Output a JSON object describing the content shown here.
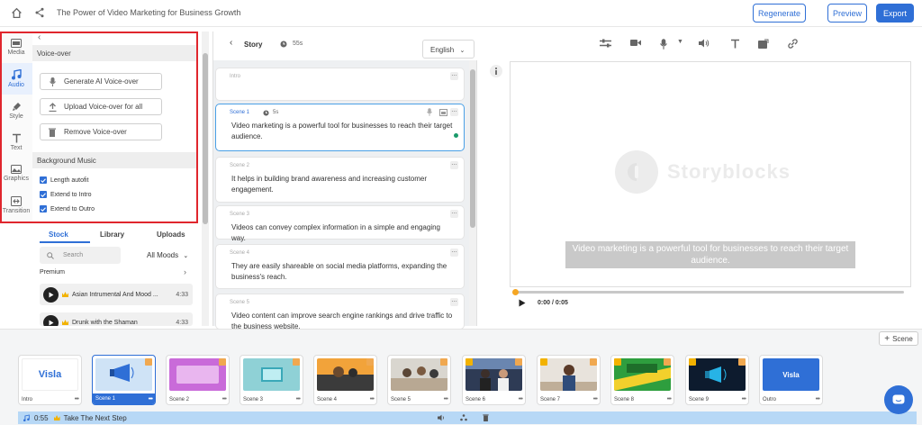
{
  "header": {
    "title": "The Power of Video Marketing for Business Growth",
    "regenerate_label": "Regenerate",
    "preview_label": "Preview",
    "export_label": "Export"
  },
  "rail": {
    "items": [
      {
        "label": "Media",
        "icon": "media-icon"
      },
      {
        "label": "Audio",
        "icon": "music-note-icon"
      },
      {
        "label": "Style",
        "icon": "brush-icon"
      },
      {
        "label": "Text",
        "icon": "text-icon"
      },
      {
        "label": "Graphics",
        "icon": "graphics-icon"
      },
      {
        "label": "Transition",
        "icon": "transition-icon"
      }
    ]
  },
  "voiceover": {
    "heading": "Voice-over",
    "buttons": [
      "Generate AI Voice-over",
      "Upload Voice-over for all",
      "Remove Voice-over"
    ],
    "music_heading": "Background Music",
    "options": [
      "Length autofit",
      "Extend to Intro",
      "Extend to Outro"
    ]
  },
  "music": {
    "tabs": [
      "Stock",
      "Library",
      "Uploads"
    ],
    "search_placeholder": "Search",
    "mood": "All Moods",
    "premium_label": "Premium",
    "tracks": [
      {
        "title": "Asian Intrumental And Mood ...",
        "duration": "4:33"
      },
      {
        "title": "Drunk with the Shaman",
        "duration": "4:33"
      }
    ]
  },
  "story": {
    "title": "Story",
    "duration": "55s",
    "language": "English",
    "intro_label": "Intro",
    "scenes": [
      {
        "label": "Scene 1",
        "duration": "5s",
        "text": "Video marketing is a powerful tool for businesses to reach their target audience."
      },
      {
        "label": "Scene 2",
        "text": "It helps in building brand awareness and increasing customer engagement."
      },
      {
        "label": "Scene 3",
        "text": "Videos can convey complex information in a simple and engaging way."
      },
      {
        "label": "Scene 4",
        "text": "They are easily shareable on social media platforms, expanding the business's reach."
      },
      {
        "label": "Scene 5",
        "text": "Video content can improve search engine rankings and drive traffic to the business website."
      }
    ]
  },
  "preview": {
    "watermark": "Storyblocks",
    "caption": "Video marketing is a powerful tool for businesses to reach their target audience.",
    "time": "0:00 / 0:05"
  },
  "timeline": {
    "add_scene_label": "Scene",
    "thumbs": [
      "Intro",
      "Scene 1",
      "Scene 2",
      "Scene 3",
      "Scene 4",
      "Scene 5",
      "Scene 6",
      "Scene 7",
      "Scene 8",
      "Scene 9",
      "Outro"
    ],
    "intro_logo": "Visla",
    "outro_logo": "Visla",
    "audio_duration": "0:55",
    "audio_title": "Take The Next Step"
  },
  "colors": {
    "accent": "#2f6fd6",
    "highlight": "#e0262d",
    "audio_bar": "#b7d8f6"
  }
}
